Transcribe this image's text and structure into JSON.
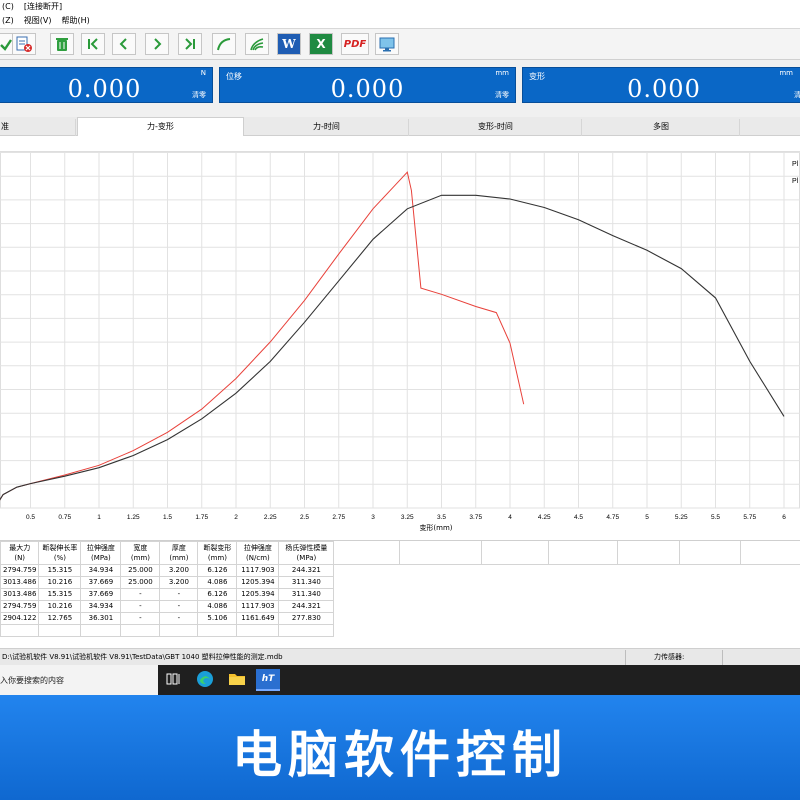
{
  "menu": {
    "row1": [
      "(C)",
      "[连接断开]"
    ],
    "row2": [
      "(Z)",
      "视图(V)",
      "帮助(H)"
    ]
  },
  "toolbar": {
    "buttons": [
      "check-icon",
      "database-delete-icon",
      "trash-icon",
      "first-icon",
      "prev-icon",
      "next-icon",
      "last-icon",
      "curve-icon",
      "multi-curve-icon",
      "word-icon",
      "excel-icon",
      "pdf-icon",
      "monitor-icon"
    ],
    "word_label": "W",
    "excel_label": "X",
    "pdf_label": "PDF"
  },
  "readouts": [
    {
      "label": "",
      "unit": "N",
      "value": "0.000",
      "zero": "清零"
    },
    {
      "label": "位移",
      "unit": "mm",
      "value": "0.000",
      "zero": "清零"
    },
    {
      "label": "变形",
      "unit": "mm",
      "value": "0.000",
      "zero": "清"
    }
  ],
  "tabs": [
    {
      "label": "准",
      "active": false
    },
    {
      "label": "力-变形",
      "active": true
    },
    {
      "label": "力-时间",
      "active": false
    },
    {
      "label": "变形-时间",
      "active": false
    },
    {
      "label": "多图",
      "active": false
    }
  ],
  "chart_data": {
    "type": "line",
    "xlabel": "变形(mm)",
    "ylabel": "",
    "xlim": [
      0,
      6
    ],
    "x_ticks": [
      ".5",
      "0.5",
      "0.75",
      "1",
      "1.25",
      "1.5",
      "1.75",
      "2",
      "2.25",
      "2.5",
      "2.75",
      "3",
      "3.25",
      "3.5",
      "3.75",
      "4",
      "4.25",
      "4.5",
      "4.75",
      "5",
      "5.25",
      "5.5",
      "5.75",
      "6"
    ],
    "grid": true,
    "legend_position": "top-right",
    "legend": [
      "Pl",
      "Pl"
    ],
    "series": [
      {
        "color": "#e8413a",
        "x": [
          0.25,
          0.3,
          0.4,
          0.5,
          0.75,
          1.0,
          1.25,
          1.5,
          1.75,
          2.0,
          2.25,
          2.5,
          2.75,
          3.0,
          3.15,
          3.25,
          3.28,
          3.35,
          3.5,
          3.75,
          3.9,
          4.0,
          4.1
        ],
        "y": [
          4,
          22,
          34,
          40,
          54,
          70,
          94,
          124,
          162,
          212,
          272,
          340,
          416,
          490,
          526,
          550,
          520,
          360,
          350,
          330,
          320,
          270,
          170
        ]
      },
      {
        "color": "#333333",
        "x": [
          0.25,
          0.3,
          0.4,
          0.5,
          0.75,
          1.0,
          1.25,
          1.5,
          1.75,
          2.0,
          2.25,
          2.5,
          2.75,
          3.0,
          3.25,
          3.5,
          3.75,
          4.0,
          4.25,
          4.5,
          4.75,
          5.0,
          5.25,
          5.5,
          5.75,
          6.0
        ],
        "y": [
          4,
          22,
          34,
          40,
          52,
          66,
          86,
          112,
          146,
          188,
          240,
          304,
          372,
          440,
          490,
          512,
          512,
          506,
          492,
          472,
          446,
          422,
          392,
          344,
          240,
          150
        ]
      }
    ]
  },
  "results": {
    "headers": [
      [
        "最大力",
        "(N)"
      ],
      [
        "断裂伸长率",
        "(%)"
      ],
      [
        "拉伸强度",
        "(MPa)"
      ],
      [
        "宽度",
        "(mm)"
      ],
      [
        "厚度",
        "(mm)"
      ],
      [
        "断裂变形",
        "(mm)"
      ],
      [
        "拉伸强度",
        "(N/cm)"
      ],
      [
        "杨氏弹性模量",
        "(MPa)"
      ]
    ],
    "rows": [
      [
        "2794.759",
        "15.315",
        "34.934",
        "25.000",
        "3.200",
        "6.126",
        "1117.903",
        "244.321"
      ],
      [
        "3013.486",
        "10.216",
        "37.669",
        "25.000",
        "3.200",
        "4.086",
        "1205.394",
        "311.340"
      ],
      [
        "3013.486",
        "15.315",
        "37.669",
        "-",
        "-",
        "6.126",
        "1205.394",
        "311.340"
      ],
      [
        "2794.759",
        "10.216",
        "34.934",
        "-",
        "-",
        "4.086",
        "1117.903",
        "244.321"
      ],
      [
        "2904.122",
        "12.765",
        "36.301",
        "-",
        "-",
        "5.106",
        "1161.649",
        "277.830"
      ]
    ]
  },
  "status": {
    "path": "D:\\试验机软件 V8.91\\试验机软件 V8.91\\TestData\\GBT 1040 塑料拉伸性能的测定.mdb",
    "sensor": "力传感器:"
  },
  "taskbar": {
    "search_text": "入你要搜索的内容",
    "app_label": "hT"
  },
  "banner": {
    "text": "电脑软件控制",
    "color": "#1879e3"
  }
}
